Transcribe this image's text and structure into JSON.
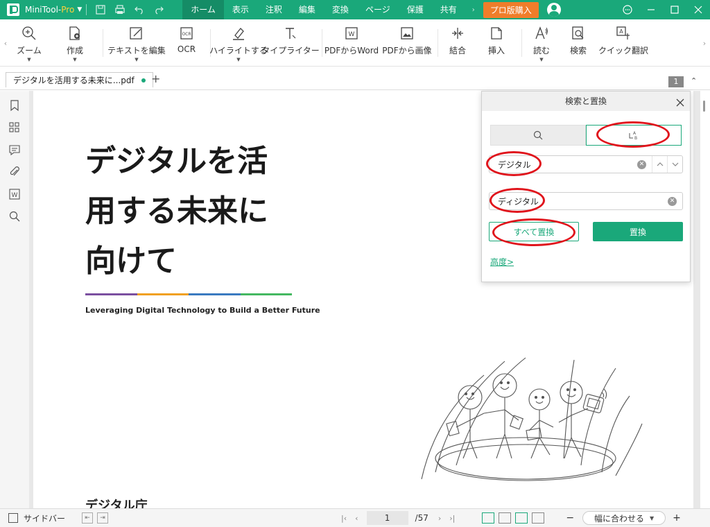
{
  "app": {
    "name": "MiniTool-",
    "edition": "Pro"
  },
  "menu": [
    "ホーム",
    "表示",
    "注釈",
    "編集",
    "変換",
    "ページ",
    "保護",
    "共有"
  ],
  "buy_label": "プロ版購入",
  "toolbar": {
    "zoom": "ズーム",
    "create": "作成",
    "edit_text": "テキストを編集",
    "ocr": "OCR",
    "highlight": "ハイライトする",
    "typewriter": "タイプライター",
    "pdf_to_word": "PDFからWord",
    "pdf_to_image": "PDFから画像",
    "merge": "結合",
    "insert": "挿入",
    "read": "読む",
    "search": "検索",
    "quick_translate": "クイック翻訳"
  },
  "tab": {
    "title": "デジタルを活用する未来に...pdf"
  },
  "page_badge": "1",
  "document": {
    "title_line1": "デジタルを活",
    "title_line2": "用する未来に",
    "title_line3": "向けて",
    "subtitle": "Leveraging Digital Technology to Build a Better Future",
    "footer": "デジタル庁"
  },
  "search_panel": {
    "title": "検索と置換",
    "find_value": "デジタル",
    "replace_value": "ディジタル",
    "replace_all_label": "すべて置換",
    "replace_label": "置換",
    "advanced_label": "高度>"
  },
  "statusbar": {
    "sidebar_label": "サイドバー",
    "current_page": "1",
    "total_pages": "/57",
    "zoom_mode": "幅に合わせる"
  },
  "colors": {
    "accent": "#1aa87a",
    "buy": "#f07d2a",
    "annotation": "#e0141c",
    "stripe": [
      "#7b4fa0",
      "#f0a020",
      "#3a7ac0",
      "#44b860"
    ]
  }
}
